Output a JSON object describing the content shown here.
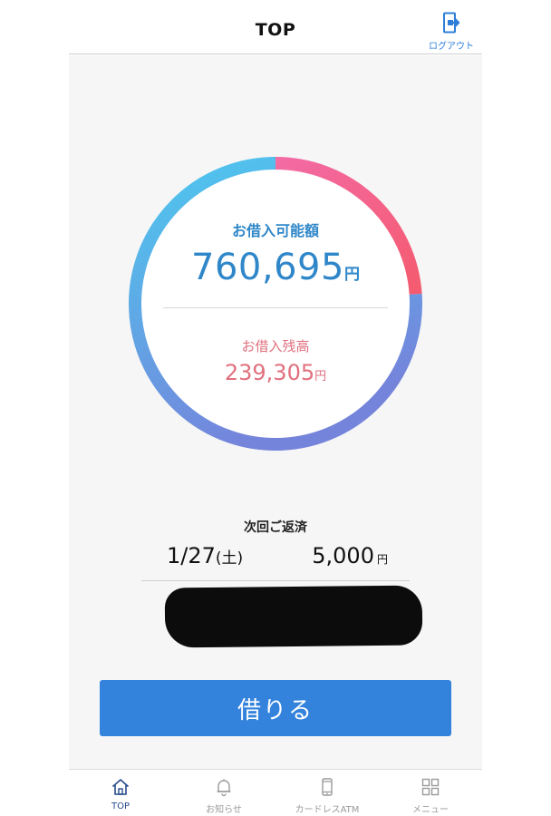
{
  "header": {
    "title": "TOP",
    "logout_label": "ログアウト"
  },
  "summary": {
    "available_label": "お借入可能額",
    "available_amount": "760,695",
    "available_unit": "円",
    "balance_label": "お借入残高",
    "balance_amount": "239,305",
    "balance_unit": "円",
    "balance_fraction": 0.239,
    "ring_colors": {
      "balance_start": "#f36aa4",
      "balance_end": "#f45b6f",
      "available_start": "#4cc9ef",
      "available_end": "#7584db"
    }
  },
  "next_payment": {
    "label": "次回ご返済",
    "date": "1/27",
    "weekday": "(土)",
    "amount": "5,000",
    "unit": "円"
  },
  "actions": {
    "borrow_label": "借りる"
  },
  "tabbar": {
    "items": [
      {
        "label": "TOP",
        "icon": "home-icon",
        "active": true
      },
      {
        "label": "お知らせ",
        "icon": "bell-icon",
        "active": false
      },
      {
        "label": "カードレスATM",
        "icon": "phone-icon",
        "active": false
      },
      {
        "label": "メニュー",
        "icon": "grid-icon",
        "active": false
      }
    ]
  },
  "colors": {
    "accent": "#3383dc",
    "available_text": "#2f87c9",
    "balance_text": "#e0707e",
    "tab_active": "#274b8c"
  }
}
